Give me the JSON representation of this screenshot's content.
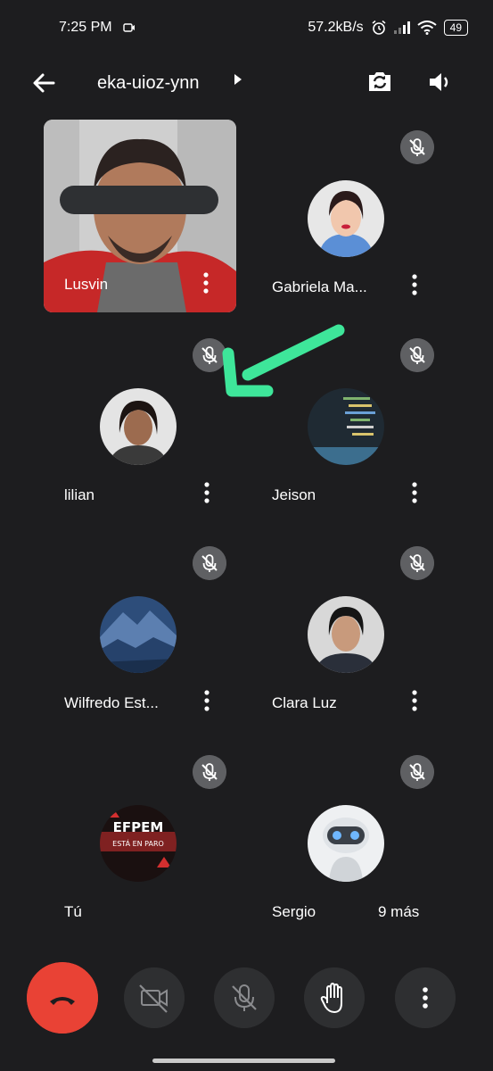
{
  "status_bar": {
    "time": "7:25 PM",
    "network_speed": "57.2kB/s",
    "battery": "49",
    "icons": [
      "video-record-icon",
      "alarm-icon",
      "signal-icon",
      "wifi-icon",
      "battery-icon"
    ]
  },
  "header": {
    "meeting_code": "eka-uioz-ynn",
    "icons": [
      "back-arrow-icon",
      "caret-right-icon",
      "camera-flip-icon",
      "speaker-icon"
    ]
  },
  "participants": [
    {
      "name": "Lusvin",
      "muted": false
    },
    {
      "name": "Gabriela Ma...",
      "muted": true
    },
    {
      "name": "lilian",
      "muted": true
    },
    {
      "name": "Jeison",
      "muted": true
    },
    {
      "name": "Wilfredo Est...",
      "muted": true
    },
    {
      "name": "Clara Luz",
      "muted": true
    },
    {
      "name": "Tú",
      "muted": true
    },
    {
      "name": "Sergio",
      "muted": true
    }
  ],
  "overflow": {
    "more_label": "9 más"
  },
  "avatar_texts": {
    "efpem_title": "EFPEM",
    "efpem_sub": "ESTÁ EN PARO"
  },
  "controls": {
    "icons": [
      "end-call-icon",
      "camera-off-icon",
      "mic-off-icon",
      "raise-hand-icon",
      "more-vert-icon"
    ]
  },
  "colors": {
    "background": "#1d1d1f",
    "end_call": "#e94235",
    "control_button": "#2e2f31",
    "annotation_arrow": "#3ee69a"
  }
}
